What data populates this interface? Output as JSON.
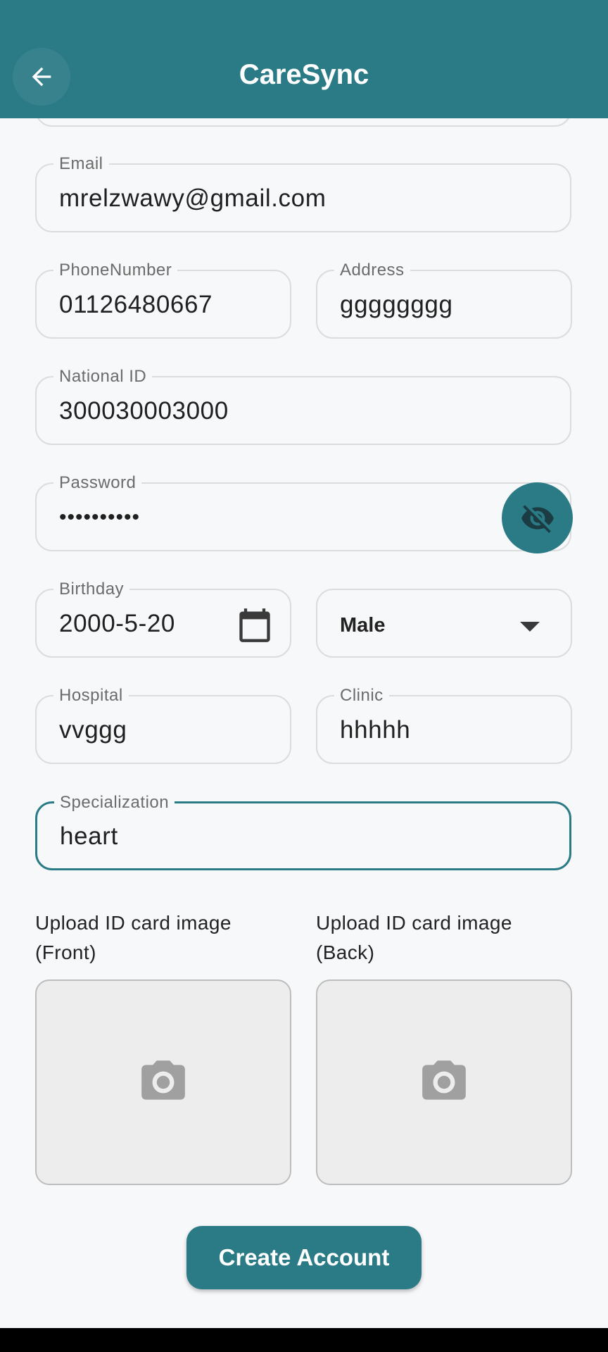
{
  "app": {
    "title": "CareSync"
  },
  "colors": {
    "primary": "#2b7b86",
    "background": "#f7f8fa",
    "border": "#dcdcdc"
  },
  "icons": {
    "back": "arrow-left-icon",
    "password_toggle": "eye-off-icon",
    "birthday": "calendar-icon",
    "gender_dropdown": "chevron-down-icon",
    "upload": "camera-icon"
  },
  "form": {
    "email": {
      "label": "Email",
      "value": "mrelzwawy@gmail.com"
    },
    "phone": {
      "label": "PhoneNumber",
      "value": "01126480667"
    },
    "address": {
      "label": "Address",
      "value": "gggggggg"
    },
    "national_id": {
      "label": "National ID",
      "value": "300030003000"
    },
    "password": {
      "label": "Password",
      "value": "••••••••••"
    },
    "birthday": {
      "label": "Birthday",
      "value": "2000-5-20"
    },
    "gender": {
      "selected": "Male"
    },
    "hospital": {
      "label": "Hospital",
      "value": "vvggg"
    },
    "clinic": {
      "label": "Clinic",
      "value": "hhhhh"
    },
    "specialization": {
      "label": "Specialization",
      "value": "heart"
    }
  },
  "uploads": {
    "front": {
      "label_line1": "Upload ID card image",
      "label_line2": "(Front)"
    },
    "back": {
      "label_line1": "Upload ID card image",
      "label_line2": "(Back)"
    }
  },
  "actions": {
    "create_account": "Create Account"
  }
}
